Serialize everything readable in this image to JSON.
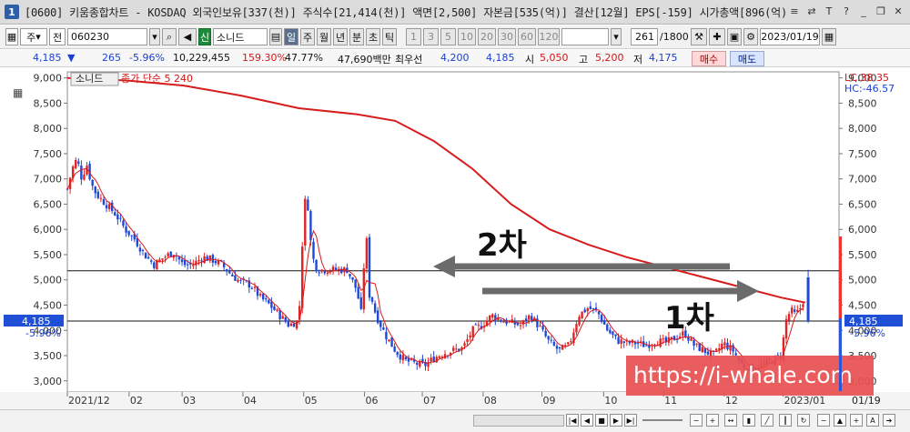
{
  "window": {
    "number": "1",
    "title": "[0600] 키움종합차트 - KOSDAQ 외국인보유[337(천)] 주식수[21,414(천)] 액면[2,500] 자본금[535(억)] 결산[12월] EPS[-159] 시가총액[896(억)"
  },
  "toolbar": {
    "type": "주",
    "mode": "전",
    "code": "060230",
    "badge": "신",
    "name": "소니드",
    "periods": [
      "일",
      "주",
      "월",
      "년",
      "분",
      "초",
      "틱"
    ],
    "numbers": [
      "1",
      "3",
      "5",
      "10",
      "20",
      "30",
      "60",
      "120"
    ],
    "count": "261",
    "count_total": "/1800",
    "date": "2023/01/19"
  },
  "quote": {
    "price": "4,185",
    "change": "265",
    "change_pct": "-5.96%",
    "volume": "10,229,455",
    "vol_ratio": "159.30%",
    "turnover": "47.77%",
    "amount": "47,690백만",
    "best_label": "최우선",
    "best_ask": "4,200",
    "best_bid": "4,185",
    "open_label": "시",
    "open": "5,050",
    "high_label": "고",
    "high": "5,200",
    "low_label": "저",
    "low": "4,175",
    "buy_label": "매수",
    "sell_label": "매도"
  },
  "legend": {
    "stock_name": "소니드",
    "ma_label": "종가 단순 5  240"
  },
  "overlay": {
    "label_2": "2차",
    "label_1": "1차",
    "watermark": "https://i-whale.com"
  },
  "right_labels": {
    "lc": "LC:38.35",
    "hc": "HC:-46.57",
    "price": "4,185",
    "pct": "-5.96%"
  },
  "left_labels": {
    "price": "4,185",
    "pct": "-5.96%"
  },
  "chart_data": {
    "type": "candlestick",
    "y_ticks": [
      "9,000",
      "8,500",
      "8,000",
      "7,500",
      "7,000",
      "6,500",
      "6,000",
      "5,500",
      "5,000",
      "4,500",
      "4,000",
      "3,500",
      "3,000"
    ],
    "y_tick_values": [
      9000,
      8500,
      8000,
      7500,
      7000,
      6500,
      6000,
      5500,
      5000,
      4500,
      4000,
      3500,
      3000
    ],
    "ylim": [
      2780,
      9120
    ],
    "x_ticks": [
      "2021/12",
      "02",
      "03",
      "04",
      "05",
      "06",
      "07",
      "08",
      "09",
      "10",
      "11",
      "12",
      "2023/01"
    ],
    "x_tick_days": [
      0,
      64,
      119,
      182,
      245,
      308,
      368,
      431,
      492,
      556,
      618,
      681,
      742
    ],
    "x_right_label": "01/19",
    "xlim_days": [
      0,
      800
    ],
    "horizontal_lines": [
      5180,
      4185
    ],
    "close_series": {
      "days": [
        0,
        5,
        10,
        15,
        20,
        25,
        30,
        40,
        50,
        60,
        70,
        80,
        90,
        100,
        110,
        120,
        130,
        140,
        150,
        160,
        170,
        180,
        190,
        200,
        210,
        220,
        230,
        240,
        245,
        248,
        252,
        256,
        260,
        265,
        270,
        280,
        290,
        300,
        305,
        308,
        310,
        312,
        314,
        316,
        320,
        325,
        330,
        340,
        350,
        360,
        370,
        380,
        390,
        400,
        410,
        420,
        430,
        440,
        450,
        460,
        470,
        480,
        490,
        500,
        510,
        520,
        530,
        540,
        550,
        560,
        570,
        580,
        590,
        600,
        610,
        620,
        630,
        640,
        650,
        660,
        670,
        680,
        690,
        700,
        710,
        720,
        730,
        740,
        745,
        750,
        755,
        760,
        765
      ],
      "values": [
        6800,
        7200,
        7400,
        7000,
        7300,
        6900,
        6700,
        6500,
        6300,
        6000,
        5800,
        5500,
        5300,
        5450,
        5550,
        5300,
        5300,
        5450,
        5400,
        5300,
        5100,
        4950,
        4900,
        4650,
        4500,
        4300,
        4100,
        4200,
        6300,
        6800,
        5800,
        5300,
        5200,
        5200,
        5200,
        5200,
        5200,
        4800,
        4300,
        5500,
        5900,
        5000,
        4500,
        4600,
        4300,
        4100,
        3900,
        3600,
        3400,
        3350,
        3300,
        3450,
        3550,
        3600,
        3650,
        4000,
        4100,
        4300,
        4200,
        4150,
        4100,
        4300,
        4050,
        3750,
        3600,
        3700,
        4300,
        4450,
        4350,
        4000,
        3800,
        3750,
        3750,
        3700,
        3800,
        3750,
        3850,
        3950,
        3700,
        3600,
        3500,
        3750,
        3600,
        3300,
        3250,
        3300,
        3400,
        3500,
        4200,
        4400,
        4300,
        4450,
        4700
      ]
    },
    "last_close": 4185,
    "last_high": 5200,
    "ma240": {
      "days": [
        0,
        60,
        120,
        180,
        240,
        300,
        340,
        380,
        420,
        460,
        500,
        540,
        580,
        620,
        660,
        700,
        740,
        765
      ],
      "values": [
        9000,
        8950,
        8850,
        8650,
        8400,
        8280,
        8150,
        7750,
        7200,
        6500,
        6000,
        5700,
        5450,
        5250,
        5050,
        4850,
        4650,
        4550
      ]
    }
  }
}
